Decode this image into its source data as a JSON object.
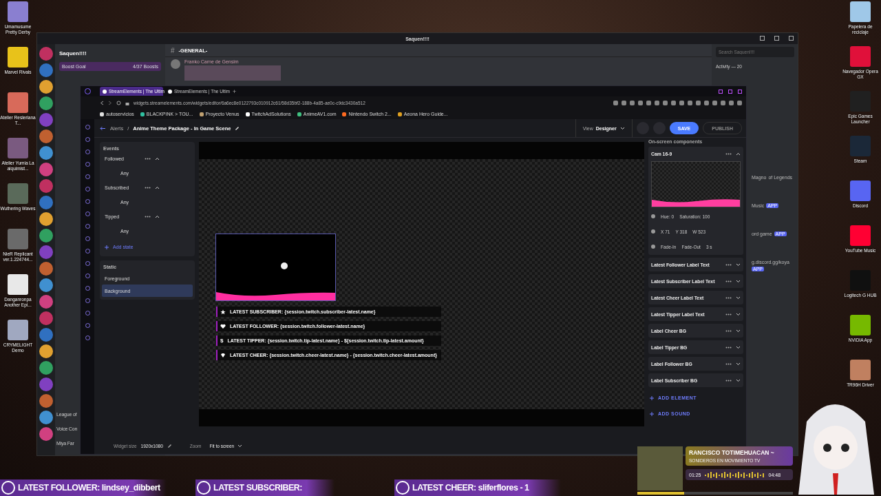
{
  "desktop": {
    "left_icons": [
      {
        "label": "Umamusume Pretty Derby",
        "color": "#8a7fd0"
      },
      {
        "label": "Marvel Rivals",
        "color": "#e8c21a"
      },
      {
        "label": "Atelier Resleriana T...",
        "color": "#d86a5a"
      },
      {
        "label": "Atelier Yumia La alquimist...",
        "color": "#7a5a80"
      },
      {
        "label": "Wuthering Waves",
        "color": "#5a6a5a"
      },
      {
        "label": "NieR Replicant ver.1.224744...",
        "color": "#6a6a6a"
      },
      {
        "label": "Danganronpa Another Epi...",
        "color": "#e8e8e8"
      },
      {
        "label": "CRYMELIGHT Demo",
        "color": "#a0a8c0"
      }
    ],
    "right_icons": [
      {
        "label": "Papelera de reciclaje",
        "color": "#9fc8e8"
      },
      {
        "label": "Navegador Opera GX",
        "color": "#e0103a"
      },
      {
        "label": "Epic Games Launcher",
        "color": "#202020"
      },
      {
        "label": "Steam",
        "color": "#1b2838"
      },
      {
        "label": "Discord",
        "color": "#5865f2"
      },
      {
        "label": "YouTube Music",
        "color": "#ff0033"
      },
      {
        "label": "Logitech G HUB",
        "color": "#101010"
      },
      {
        "label": "NVIDIA App",
        "color": "#76b900"
      },
      {
        "label": "TR96H Driver",
        "color": "#c08060"
      }
    ]
  },
  "discord": {
    "title": "Saquen!!!!",
    "server_name": "Saquen!!!!",
    "boost_goal": "Boost Goal",
    "boost_count": "4/37 Boosts",
    "channel_hash": "#",
    "channel": "-GENERAL-",
    "message_author": "Franko Carne de Gensim",
    "search": {
      "placeholder": "Search Saquen!!!!"
    },
    "activity": "Activity — 20",
    "channels": [
      "League of",
      "Voice Con",
      "Miya Far"
    ],
    "members": [
      {
        "name": "Magno",
        "sub": "of Legends"
      },
      {
        "name": "Music",
        "badge": "APP"
      },
      {
        "name": "ord game",
        "badge": "APP"
      },
      {
        "name": "g.discord.gg/koya",
        "badge": "APP"
      }
    ]
  },
  "browser": {
    "new_tab": "+",
    "tabs": [
      {
        "label": "StreamElements | The Ultim",
        "selected": true
      },
      {
        "label": "StreamElements | The Ultim",
        "selected": false
      }
    ],
    "url": "widgets.streamelements.com/widgets/editor/6a6ec8e0122793c010912c61/58d35bf2-188b-4a85-ae0c-c9dc3430a512",
    "bookmarks": [
      {
        "label": "autoservicios",
        "color": "#e0e0e0"
      },
      {
        "label": "BLACKPINK > TOU...",
        "color": "#30c0a0"
      },
      {
        "label": "Proyecto Venus",
        "color": "#c0a070"
      },
      {
        "label": "TwitchAdSolutions",
        "color": "#ffffff"
      },
      {
        "label": "AnimeAV1.com",
        "color": "#40c080"
      },
      {
        "label": "Nintendo Switch 2...",
        "color": "#ff6a20"
      },
      {
        "label": "Aeona Hero Guide...",
        "color": "#e0a020"
      }
    ]
  },
  "editor": {
    "breadcrumb": "Alerts",
    "separator": "/",
    "title": "Anime Theme Package - In Game Scene",
    "view_label": "View",
    "view_value": "Designer",
    "buttons": [
      {
        "label": "SAVE",
        "disabled": false
      },
      {
        "label": "PUBLISH",
        "disabled": true
      }
    ],
    "events_title": "Events",
    "events": [
      {
        "label": "Followed",
        "expanded": true,
        "state": "Any"
      },
      {
        "label": "Subscribed",
        "expanded": true,
        "state": "Any"
      },
      {
        "label": "Tipped",
        "expanded": true,
        "state": "Any"
      }
    ],
    "add_state": "Add state",
    "static_title": "Static",
    "static_items": [
      {
        "label": "Foreground",
        "selected": false
      },
      {
        "label": "Background",
        "selected": true
      }
    ],
    "tip_symbol": "$",
    "canvas_labels": [
      "LATEST SUBSCRIBER: {session.twitch.subscriber-latest.name}",
      "LATEST FOLLOWER: {session.twitch.follower-latest.name}",
      "LATEST TIPPER: {session.twitch.tip-latest.name} - ${session.twitch.tip-latest.amount}",
      "LATEST CHEER: {session.twitch.cheer-latest.name} - {session.twitch.cheer-latest.amount}"
    ],
    "components_title": "On-screen components",
    "components": [
      {
        "label": "Cam 16-9",
        "expanded": true,
        "hue": "Hue: 0",
        "saturation": "Saturation: 100",
        "x": "X 71",
        "y": "Y 318",
        "w": "W 523",
        "fade_in": "Fade-In",
        "fade_out": "Fade-Out",
        "duration": "3 s"
      },
      {
        "label": "Latest Follower Label Text",
        "expanded": false
      },
      {
        "label": "Latest Subscriber Label Text",
        "expanded": false
      },
      {
        "label": "Latest Cheer Label Text",
        "expanded": false
      },
      {
        "label": "Latest Tipper Label Text",
        "expanded": false
      },
      {
        "label": "Label Cheer BG",
        "expanded": false
      },
      {
        "label": "Label Tipper BG",
        "expanded": false
      },
      {
        "label": "Label Follower BG",
        "expanded": false
      },
      {
        "label": "Label Subscriber BG",
        "expanded": false
      }
    ],
    "add_element": "ADD ELEMENT",
    "add_sound": "ADD SOUND",
    "widget_size_label": "Widget size",
    "widget_size": "1920x1080",
    "zoom_label": "Zoom",
    "zoom_value": "Fit to screen"
  },
  "overlay": {
    "banners": [
      "LATEST FOLLOWER: lindsey_dibbert",
      "LATEST SUBSCRIBER:",
      "LATEST CHEER: sliferflores - 1"
    ],
    "music": {
      "title": "RANCISCO TOTIMEHUACAN ~",
      "artist": "SONIDEROS EN MOVIMIENTO TV",
      "elapsed": "01:25",
      "total": "04:48",
      "level": 0.3
    }
  }
}
